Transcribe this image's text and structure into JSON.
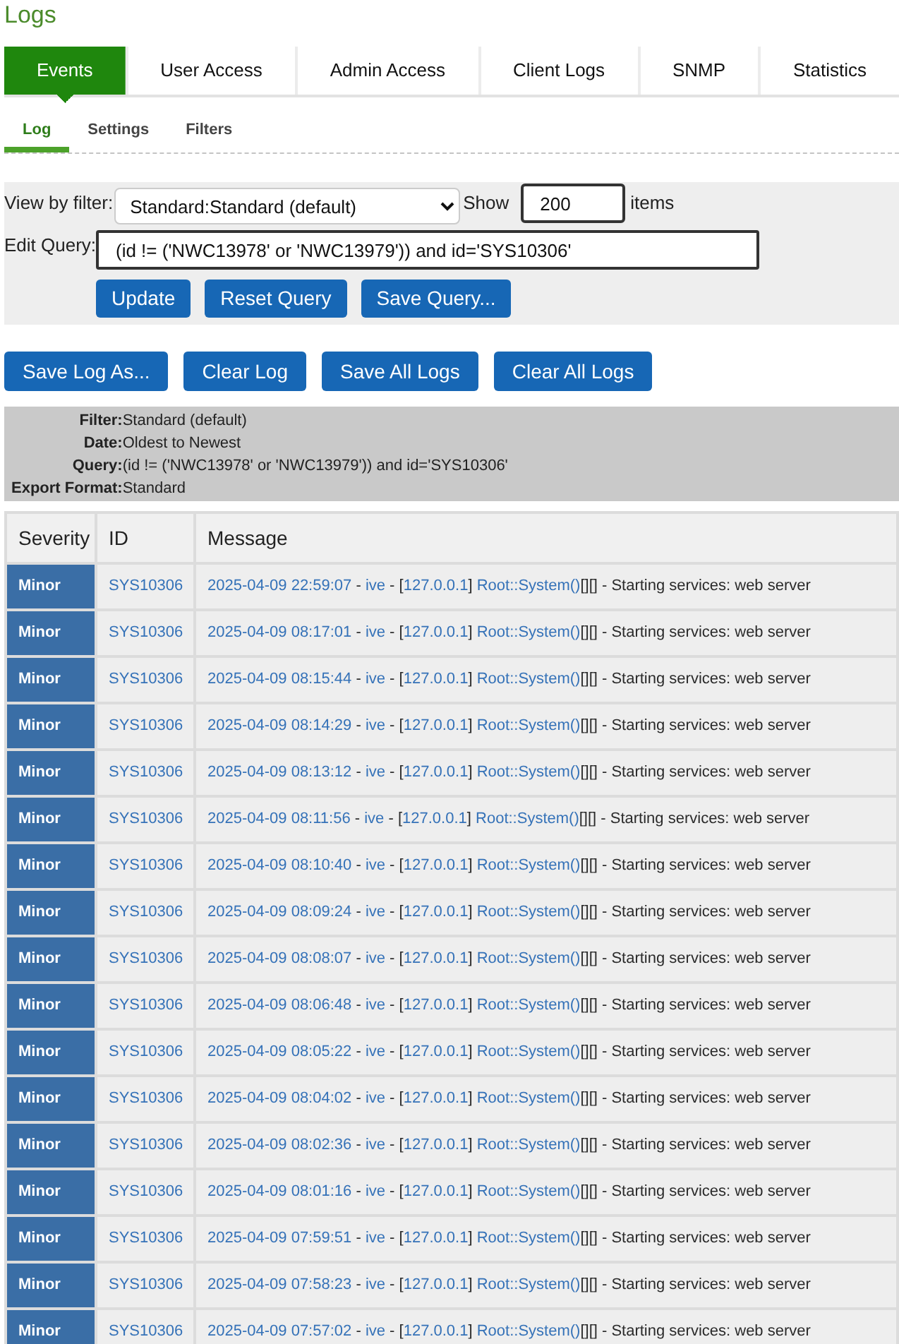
{
  "page": {
    "title": "Logs"
  },
  "tabs": [
    {
      "label": "Events",
      "selected": true
    },
    {
      "label": "User Access",
      "selected": false
    },
    {
      "label": "Admin Access",
      "selected": false
    },
    {
      "label": "Client Logs",
      "selected": false
    },
    {
      "label": "SNMP",
      "selected": false
    },
    {
      "label": "Statistics",
      "selected": false
    }
  ],
  "subtabs": [
    {
      "label": "Log",
      "selected": true
    },
    {
      "label": "Settings",
      "selected": false
    },
    {
      "label": "Filters",
      "selected": false
    }
  ],
  "filter_panel": {
    "view_label": "View by filter:",
    "filter_value": "Standard:Standard (default)",
    "show_label": "Show",
    "show_value": "200",
    "items_label": "items",
    "query_label": "Edit Query:",
    "query_value": "(id != ('NWC13978' or 'NWC13979')) and id='SYS10306'",
    "buttons": [
      "Update",
      "Reset Query",
      "Save Query..."
    ]
  },
  "log_buttons": [
    "Save Log As...",
    "Clear Log",
    "Save All Logs",
    "Clear All Logs"
  ],
  "summary": [
    {
      "label": "Filter:",
      "value": "Standard (default)"
    },
    {
      "label": "Date:",
      "value": "Oldest to Newest"
    },
    {
      "label": "Query:",
      "value": "(id != ('NWC13978' or 'NWC13979')) and id='SYS10306'"
    },
    {
      "label": "Export Format:",
      "value": "Standard"
    }
  ],
  "table": {
    "columns": [
      "Severity",
      "ID",
      "Message"
    ],
    "rows": [
      {
        "severity": "Minor",
        "id": "SYS10306",
        "message": [
          {
            "kind": "timestamp",
            "text": "2025-04-09 22:59:07"
          },
          {
            "kind": "text",
            "text": " - "
          },
          {
            "kind": "user",
            "text": "ive"
          },
          {
            "kind": "text",
            "text": " - ["
          },
          {
            "kind": "address",
            "text": "127.0.0.1"
          },
          {
            "kind": "text",
            "text": "] "
          },
          {
            "kind": "source",
            "text": "Root::System()"
          },
          {
            "kind": "text",
            "text": "[][] - Starting services: web server"
          }
        ]
      },
      {
        "severity": "Minor",
        "id": "SYS10306",
        "message": [
          {
            "kind": "timestamp",
            "text": "2025-04-09 08:17:01"
          },
          {
            "kind": "text",
            "text": " - "
          },
          {
            "kind": "user",
            "text": "ive"
          },
          {
            "kind": "text",
            "text": " - ["
          },
          {
            "kind": "address",
            "text": "127.0.0.1"
          },
          {
            "kind": "text",
            "text": "] "
          },
          {
            "kind": "source",
            "text": "Root::System()"
          },
          {
            "kind": "text",
            "text": "[][] - Starting services: web server"
          }
        ]
      },
      {
        "severity": "Minor",
        "id": "SYS10306",
        "message": [
          {
            "kind": "timestamp",
            "text": "2025-04-09 08:15:44"
          },
          {
            "kind": "text",
            "text": " - "
          },
          {
            "kind": "user",
            "text": "ive"
          },
          {
            "kind": "text",
            "text": " - ["
          },
          {
            "kind": "address",
            "text": "127.0.0.1"
          },
          {
            "kind": "text",
            "text": "] "
          },
          {
            "kind": "source",
            "text": "Root::System()"
          },
          {
            "kind": "text",
            "text": "[][] - Starting services: web server"
          }
        ]
      },
      {
        "severity": "Minor",
        "id": "SYS10306",
        "message": [
          {
            "kind": "timestamp",
            "text": "2025-04-09 08:14:29"
          },
          {
            "kind": "text",
            "text": " - "
          },
          {
            "kind": "user",
            "text": "ive"
          },
          {
            "kind": "text",
            "text": " - ["
          },
          {
            "kind": "address",
            "text": "127.0.0.1"
          },
          {
            "kind": "text",
            "text": "] "
          },
          {
            "kind": "source",
            "text": "Root::System()"
          },
          {
            "kind": "text",
            "text": "[][] - Starting services: web server"
          }
        ]
      },
      {
        "severity": "Minor",
        "id": "SYS10306",
        "message": [
          {
            "kind": "timestamp",
            "text": "2025-04-09 08:13:12"
          },
          {
            "kind": "text",
            "text": " - "
          },
          {
            "kind": "user",
            "text": "ive"
          },
          {
            "kind": "text",
            "text": " - ["
          },
          {
            "kind": "address",
            "text": "127.0.0.1"
          },
          {
            "kind": "text",
            "text": "] "
          },
          {
            "kind": "source",
            "text": "Root::System()"
          },
          {
            "kind": "text",
            "text": "[][] - Starting services: web server"
          }
        ]
      },
      {
        "severity": "Minor",
        "id": "SYS10306",
        "message": [
          {
            "kind": "timestamp",
            "text": "2025-04-09 08:11:56"
          },
          {
            "kind": "text",
            "text": " - "
          },
          {
            "kind": "user",
            "text": "ive"
          },
          {
            "kind": "text",
            "text": " - ["
          },
          {
            "kind": "address",
            "text": "127.0.0.1"
          },
          {
            "kind": "text",
            "text": "] "
          },
          {
            "kind": "source",
            "text": "Root::System()"
          },
          {
            "kind": "text",
            "text": "[][] - Starting services: web server"
          }
        ]
      },
      {
        "severity": "Minor",
        "id": "SYS10306",
        "message": [
          {
            "kind": "timestamp",
            "text": "2025-04-09 08:10:40"
          },
          {
            "kind": "text",
            "text": " - "
          },
          {
            "kind": "user",
            "text": "ive"
          },
          {
            "kind": "text",
            "text": " - ["
          },
          {
            "kind": "address",
            "text": "127.0.0.1"
          },
          {
            "kind": "text",
            "text": "] "
          },
          {
            "kind": "source",
            "text": "Root::System()"
          },
          {
            "kind": "text",
            "text": "[][] - Starting services: web server"
          }
        ]
      },
      {
        "severity": "Minor",
        "id": "SYS10306",
        "message": [
          {
            "kind": "timestamp",
            "text": "2025-04-09 08:09:24"
          },
          {
            "kind": "text",
            "text": " - "
          },
          {
            "kind": "user",
            "text": "ive"
          },
          {
            "kind": "text",
            "text": " - ["
          },
          {
            "kind": "address",
            "text": "127.0.0.1"
          },
          {
            "kind": "text",
            "text": "] "
          },
          {
            "kind": "source",
            "text": "Root::System()"
          },
          {
            "kind": "text",
            "text": "[][] - Starting services: web server"
          }
        ]
      },
      {
        "severity": "Minor",
        "id": "SYS10306",
        "message": [
          {
            "kind": "timestamp",
            "text": "2025-04-09 08:08:07"
          },
          {
            "kind": "text",
            "text": " - "
          },
          {
            "kind": "user",
            "text": "ive"
          },
          {
            "kind": "text",
            "text": " - ["
          },
          {
            "kind": "address",
            "text": "127.0.0.1"
          },
          {
            "kind": "text",
            "text": "] "
          },
          {
            "kind": "source",
            "text": "Root::System()"
          },
          {
            "kind": "text",
            "text": "[][] - Starting services: web server"
          }
        ]
      },
      {
        "severity": "Minor",
        "id": "SYS10306",
        "message": [
          {
            "kind": "timestamp",
            "text": "2025-04-09 08:06:48"
          },
          {
            "kind": "text",
            "text": " - "
          },
          {
            "kind": "user",
            "text": "ive"
          },
          {
            "kind": "text",
            "text": " - ["
          },
          {
            "kind": "address",
            "text": "127.0.0.1"
          },
          {
            "kind": "text",
            "text": "] "
          },
          {
            "kind": "source",
            "text": "Root::System()"
          },
          {
            "kind": "text",
            "text": "[][] - Starting services: web server"
          }
        ]
      },
      {
        "severity": "Minor",
        "id": "SYS10306",
        "message": [
          {
            "kind": "timestamp",
            "text": "2025-04-09 08:05:22"
          },
          {
            "kind": "text",
            "text": " - "
          },
          {
            "kind": "user",
            "text": "ive"
          },
          {
            "kind": "text",
            "text": " - ["
          },
          {
            "kind": "address",
            "text": "127.0.0.1"
          },
          {
            "kind": "text",
            "text": "] "
          },
          {
            "kind": "source",
            "text": "Root::System()"
          },
          {
            "kind": "text",
            "text": "[][] - Starting services: web server"
          }
        ]
      },
      {
        "severity": "Minor",
        "id": "SYS10306",
        "message": [
          {
            "kind": "timestamp",
            "text": "2025-04-09 08:04:02"
          },
          {
            "kind": "text",
            "text": " - "
          },
          {
            "kind": "user",
            "text": "ive"
          },
          {
            "kind": "text",
            "text": " - ["
          },
          {
            "kind": "address",
            "text": "127.0.0.1"
          },
          {
            "kind": "text",
            "text": "] "
          },
          {
            "kind": "source",
            "text": "Root::System()"
          },
          {
            "kind": "text",
            "text": "[][] - Starting services: web server"
          }
        ]
      },
      {
        "severity": "Minor",
        "id": "SYS10306",
        "message": [
          {
            "kind": "timestamp",
            "text": "2025-04-09 08:02:36"
          },
          {
            "kind": "text",
            "text": " - "
          },
          {
            "kind": "user",
            "text": "ive"
          },
          {
            "kind": "text",
            "text": " - ["
          },
          {
            "kind": "address",
            "text": "127.0.0.1"
          },
          {
            "kind": "text",
            "text": "] "
          },
          {
            "kind": "source",
            "text": "Root::System()"
          },
          {
            "kind": "text",
            "text": "[][] - Starting services: web server"
          }
        ]
      },
      {
        "severity": "Minor",
        "id": "SYS10306",
        "message": [
          {
            "kind": "timestamp",
            "text": "2025-04-09 08:01:16"
          },
          {
            "kind": "text",
            "text": " - "
          },
          {
            "kind": "user",
            "text": "ive"
          },
          {
            "kind": "text",
            "text": " - ["
          },
          {
            "kind": "address",
            "text": "127.0.0.1"
          },
          {
            "kind": "text",
            "text": "] "
          },
          {
            "kind": "source",
            "text": "Root::System()"
          },
          {
            "kind": "text",
            "text": "[][] - Starting services: web server"
          }
        ]
      },
      {
        "severity": "Minor",
        "id": "SYS10306",
        "message": [
          {
            "kind": "timestamp",
            "text": "2025-04-09 07:59:51"
          },
          {
            "kind": "text",
            "text": " - "
          },
          {
            "kind": "user",
            "text": "ive"
          },
          {
            "kind": "text",
            "text": " - ["
          },
          {
            "kind": "address",
            "text": "127.0.0.1"
          },
          {
            "kind": "text",
            "text": "] "
          },
          {
            "kind": "source",
            "text": "Root::System()"
          },
          {
            "kind": "text",
            "text": "[][] - Starting services: web server"
          }
        ]
      },
      {
        "severity": "Minor",
        "id": "SYS10306",
        "message": [
          {
            "kind": "timestamp",
            "text": "2025-04-09 07:58:23"
          },
          {
            "kind": "text",
            "text": " - "
          },
          {
            "kind": "user",
            "text": "ive"
          },
          {
            "kind": "text",
            "text": " - ["
          },
          {
            "kind": "address",
            "text": "127.0.0.1"
          },
          {
            "kind": "text",
            "text": "] "
          },
          {
            "kind": "source",
            "text": "Root::System()"
          },
          {
            "kind": "text",
            "text": "[][] - Starting services: web server"
          }
        ]
      },
      {
        "severity": "Minor",
        "id": "SYS10306",
        "message": [
          {
            "kind": "timestamp",
            "text": "2025-04-09 07:57:02"
          },
          {
            "kind": "text",
            "text": " - "
          },
          {
            "kind": "user",
            "text": "ive"
          },
          {
            "kind": "text",
            "text": " - ["
          },
          {
            "kind": "address",
            "text": "127.0.0.1"
          },
          {
            "kind": "text",
            "text": "] "
          },
          {
            "kind": "source",
            "text": "Root::System()"
          },
          {
            "kind": "text",
            "text": "[][] - Starting services: web server"
          }
        ]
      }
    ]
  }
}
